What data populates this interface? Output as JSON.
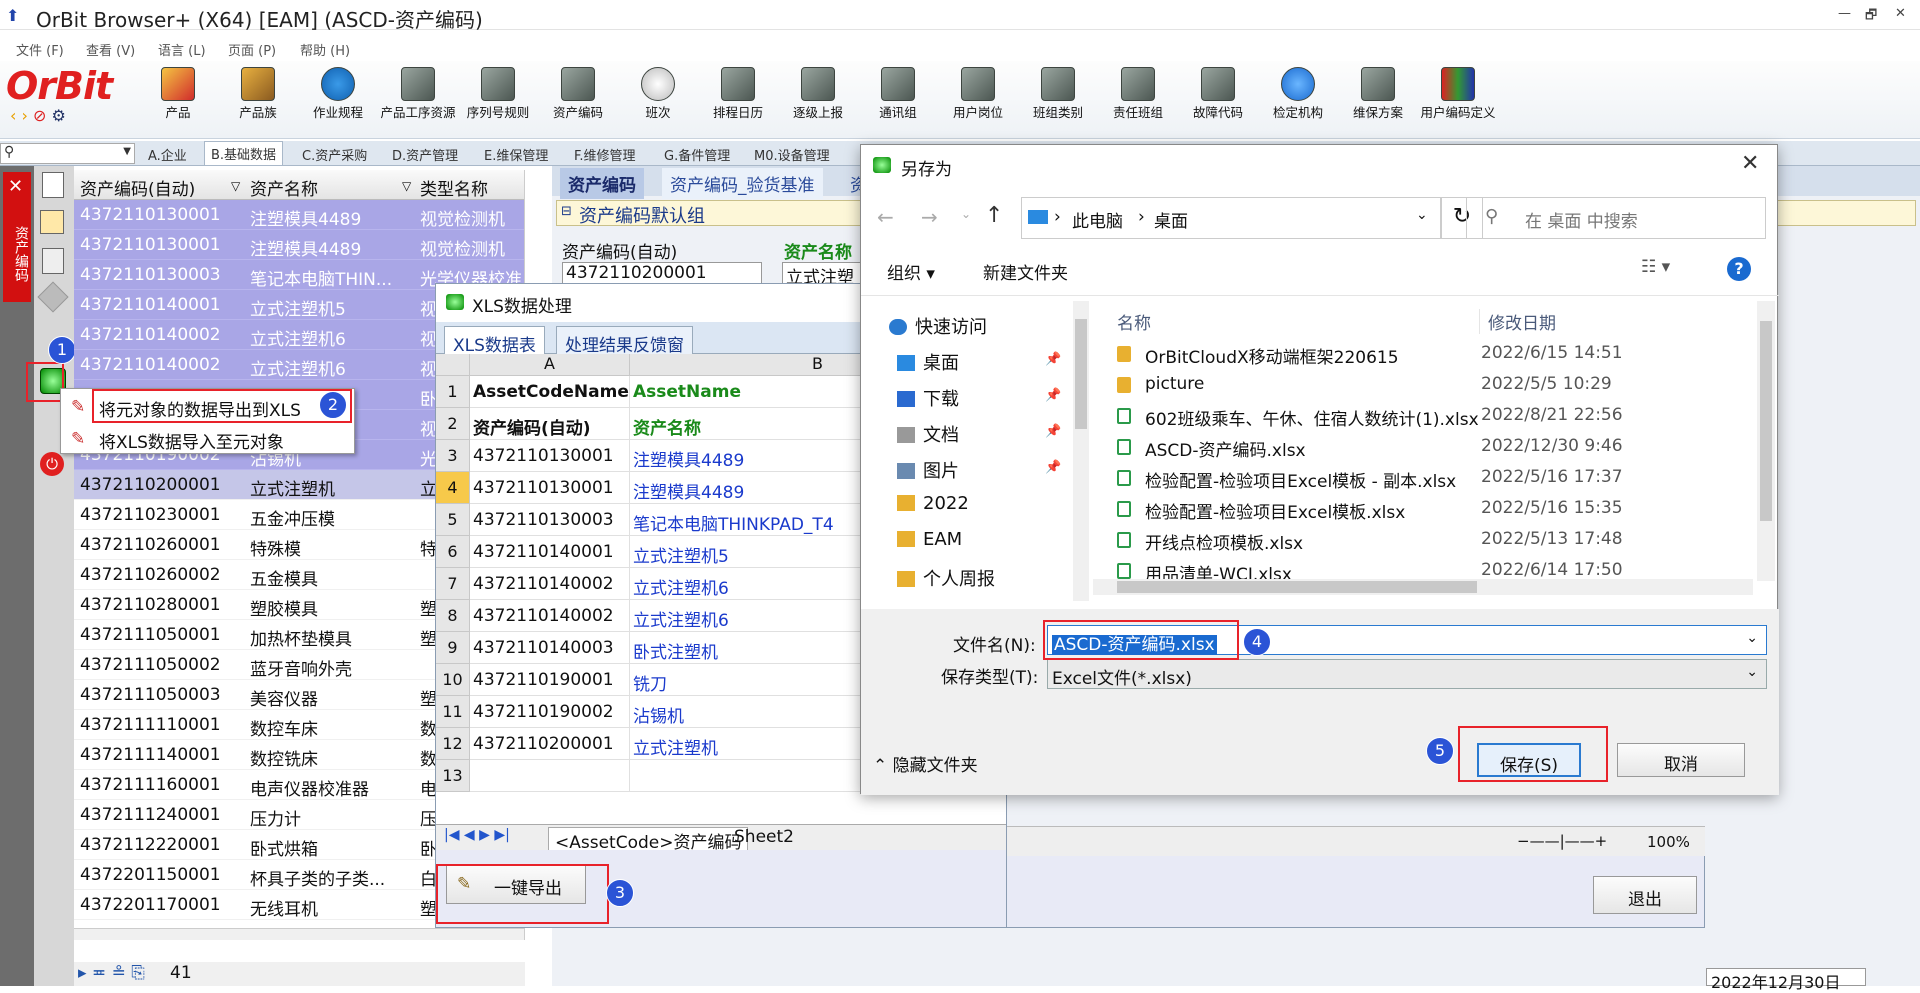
{
  "window": {
    "title": "OrBit Browser+ (X64) [EAM] (ASCD-资产编码)",
    "controls": [
      "—",
      "🗗",
      "✕"
    ]
  },
  "menu": [
    "文件 (F)",
    "查看 (V)",
    "语言 (L)",
    "页面 (P)",
    "帮助 (H)"
  ],
  "logo": "OrBit",
  "toolbar": [
    "产品",
    "产品族",
    "作业规程",
    "产品工序资源",
    "序列号规则",
    "资产编码",
    "班次",
    "排程日历",
    "逐级上报",
    "通讯组",
    "用户岗位",
    "班组类别",
    "责任班组",
    "故障代码",
    "检定机构",
    "维保方案",
    "用户编码定义"
  ],
  "tabs": [
    "A.企业",
    "B.基础数据",
    "C.资产采购",
    "D.资产管理",
    "E.维保管理",
    "F.维修管理",
    "G.备件管理",
    "M0.设备管理"
  ],
  "side_tab": "资产编码",
  "grid": {
    "headers": [
      "资产编码(自动)",
      "资产名称",
      "类型名称"
    ],
    "rows": [
      [
        "4372110130001",
        "注塑模具4489",
        "视觉检测机"
      ],
      [
        "4372110130001",
        "注塑模具4489",
        "视觉检测机"
      ],
      [
        "4372110130003",
        "笔记本电脑THIN...",
        "光学仪器校准"
      ],
      [
        "4372110140001",
        "立式注塑机5",
        "视"
      ],
      [
        "4372110140002",
        "立式注塑机6",
        "视"
      ],
      [
        "4372110140002",
        "立式注塑机6",
        "视"
      ],
      [
        "",
        "",
        "卧"
      ],
      [
        "",
        "",
        "视"
      ],
      [
        "4372110190002",
        "沾锡机",
        "光"
      ],
      [
        "4372110200001",
        "立式注塑机",
        "立"
      ],
      [
        "4372110230001",
        "五金冲压模",
        ""
      ],
      [
        "4372110260001",
        "特殊模",
        "特"
      ],
      [
        "4372110260002",
        "五金模具",
        ""
      ],
      [
        "4372110280001",
        "塑胶模具",
        "塑"
      ],
      [
        "4372111050001",
        "加热杯垫模具",
        "塑"
      ],
      [
        "4372111050002",
        "蓝牙音响外壳",
        ""
      ],
      [
        "4372111050003",
        "美容仪器",
        "塑"
      ],
      [
        "4372111110001",
        "数控车床",
        "数"
      ],
      [
        "4372111140001",
        "数控铣床",
        "数"
      ],
      [
        "4372111160001",
        "电声仪器校准器",
        "电"
      ],
      [
        "4372111240001",
        "压力计",
        "压"
      ],
      [
        "4372112220001",
        "卧式烘箱",
        "卧"
      ],
      [
        "4372201150001",
        "杯具子类的子类...",
        "白"
      ],
      [
        "4372201170001",
        "无线耳机",
        "塑"
      ]
    ],
    "record_count": "41"
  },
  "context_menu": [
    "将元对象的数据导出到XLS",
    "将XLS数据导入至元对象"
  ],
  "badges": [
    "1",
    "2",
    "3",
    "4",
    "5"
  ],
  "panel": {
    "tabs": [
      "资产编码",
      "资产编码_验货基准",
      "资"
    ],
    "group": "资产编码默认组",
    "field1_label": "资产编码(自动)",
    "field1_value": "4372110200001",
    "field2_label": "资产名称",
    "field2_value": "立式注塑"
  },
  "xls": {
    "title": "XLS数据处理",
    "tabs": [
      "XLS数据表",
      "处理结果反馈窗"
    ],
    "col_headers": [
      "A",
      "B"
    ],
    "rows": [
      [
        "1",
        "AssetCodeName",
        "AssetName"
      ],
      [
        "2",
        "资产编码(自动)",
        "资产名称"
      ],
      [
        "3",
        "4372110130001",
        "注塑模具4489"
      ],
      [
        "4",
        "4372110130001",
        "注塑模具4489"
      ],
      [
        "5",
        "4372110130003",
        "笔记本电脑THINKPAD_T4"
      ],
      [
        "6",
        "4372110140001",
        "立式注塑机5"
      ],
      [
        "7",
        "4372110140002",
        "立式注塑机6"
      ],
      [
        "8",
        "4372110140002",
        "立式注塑机6"
      ],
      [
        "9",
        "4372110140003",
        "卧式注塑机"
      ],
      [
        "10",
        "4372110190001",
        "铣刀"
      ],
      [
        "11",
        "4372110190002",
        "沾锡机"
      ],
      [
        "12",
        "4372110200001",
        "立式注塑机"
      ],
      [
        "13",
        "",
        ""
      ]
    ],
    "sheet_tabs": [
      "<AssetCode>资产编码",
      "Sheet2"
    ],
    "export_button": "一键导出",
    "exit_button": "退出",
    "zoom": "100%"
  },
  "save_dialog": {
    "title": "另存为",
    "path": [
      "此电脑",
      "桌面"
    ],
    "search_placeholder": "在 桌面 中搜索",
    "organize": "组织 ▾",
    "new_folder": "新建文件夹",
    "nav": [
      "快速访问",
      "桌面",
      "下载",
      "文档",
      "图片",
      "2022",
      "EAM",
      "个人周报"
    ],
    "col_name": "名称",
    "col_date": "修改日期",
    "files": [
      [
        "OrBitCloudX移动端框架220615",
        "2022/6/15 14:51",
        "folder"
      ],
      [
        "picture",
        "2022/5/5 10:29",
        "folder"
      ],
      [
        "602班级乘车、午休、住宿人数统计(1).xlsx",
        "2022/8/21 22:56",
        "xlsx"
      ],
      [
        "ASCD-资产编码.xlsx",
        "2022/12/30 9:46",
        "xlsx"
      ],
      [
        "检验配置-检验项目Excel模板 - 副本.xlsx",
        "2022/5/16 17:37",
        "xlsx"
      ],
      [
        "检验配置-检验项目Excel模板.xlsx",
        "2022/5/16 15:35",
        "xlsx"
      ],
      [
        "开线点检项模板.xlsx",
        "2022/5/13 17:48",
        "xlsx"
      ],
      [
        "用品清单-WCJ.xlsx",
        "2022/6/14 17:50",
        "xlsx"
      ]
    ],
    "filename_label": "文件名(N):",
    "filename_value": "ASCD-资产编码.xlsx",
    "filetype_label": "保存类型(T):",
    "filetype_value": "Excel文件(*.xlsx)",
    "hide_folders": "隐藏文件夹",
    "save_button": "保存(S)",
    "cancel_button": "取消"
  },
  "status_date": "2022年12月30日"
}
